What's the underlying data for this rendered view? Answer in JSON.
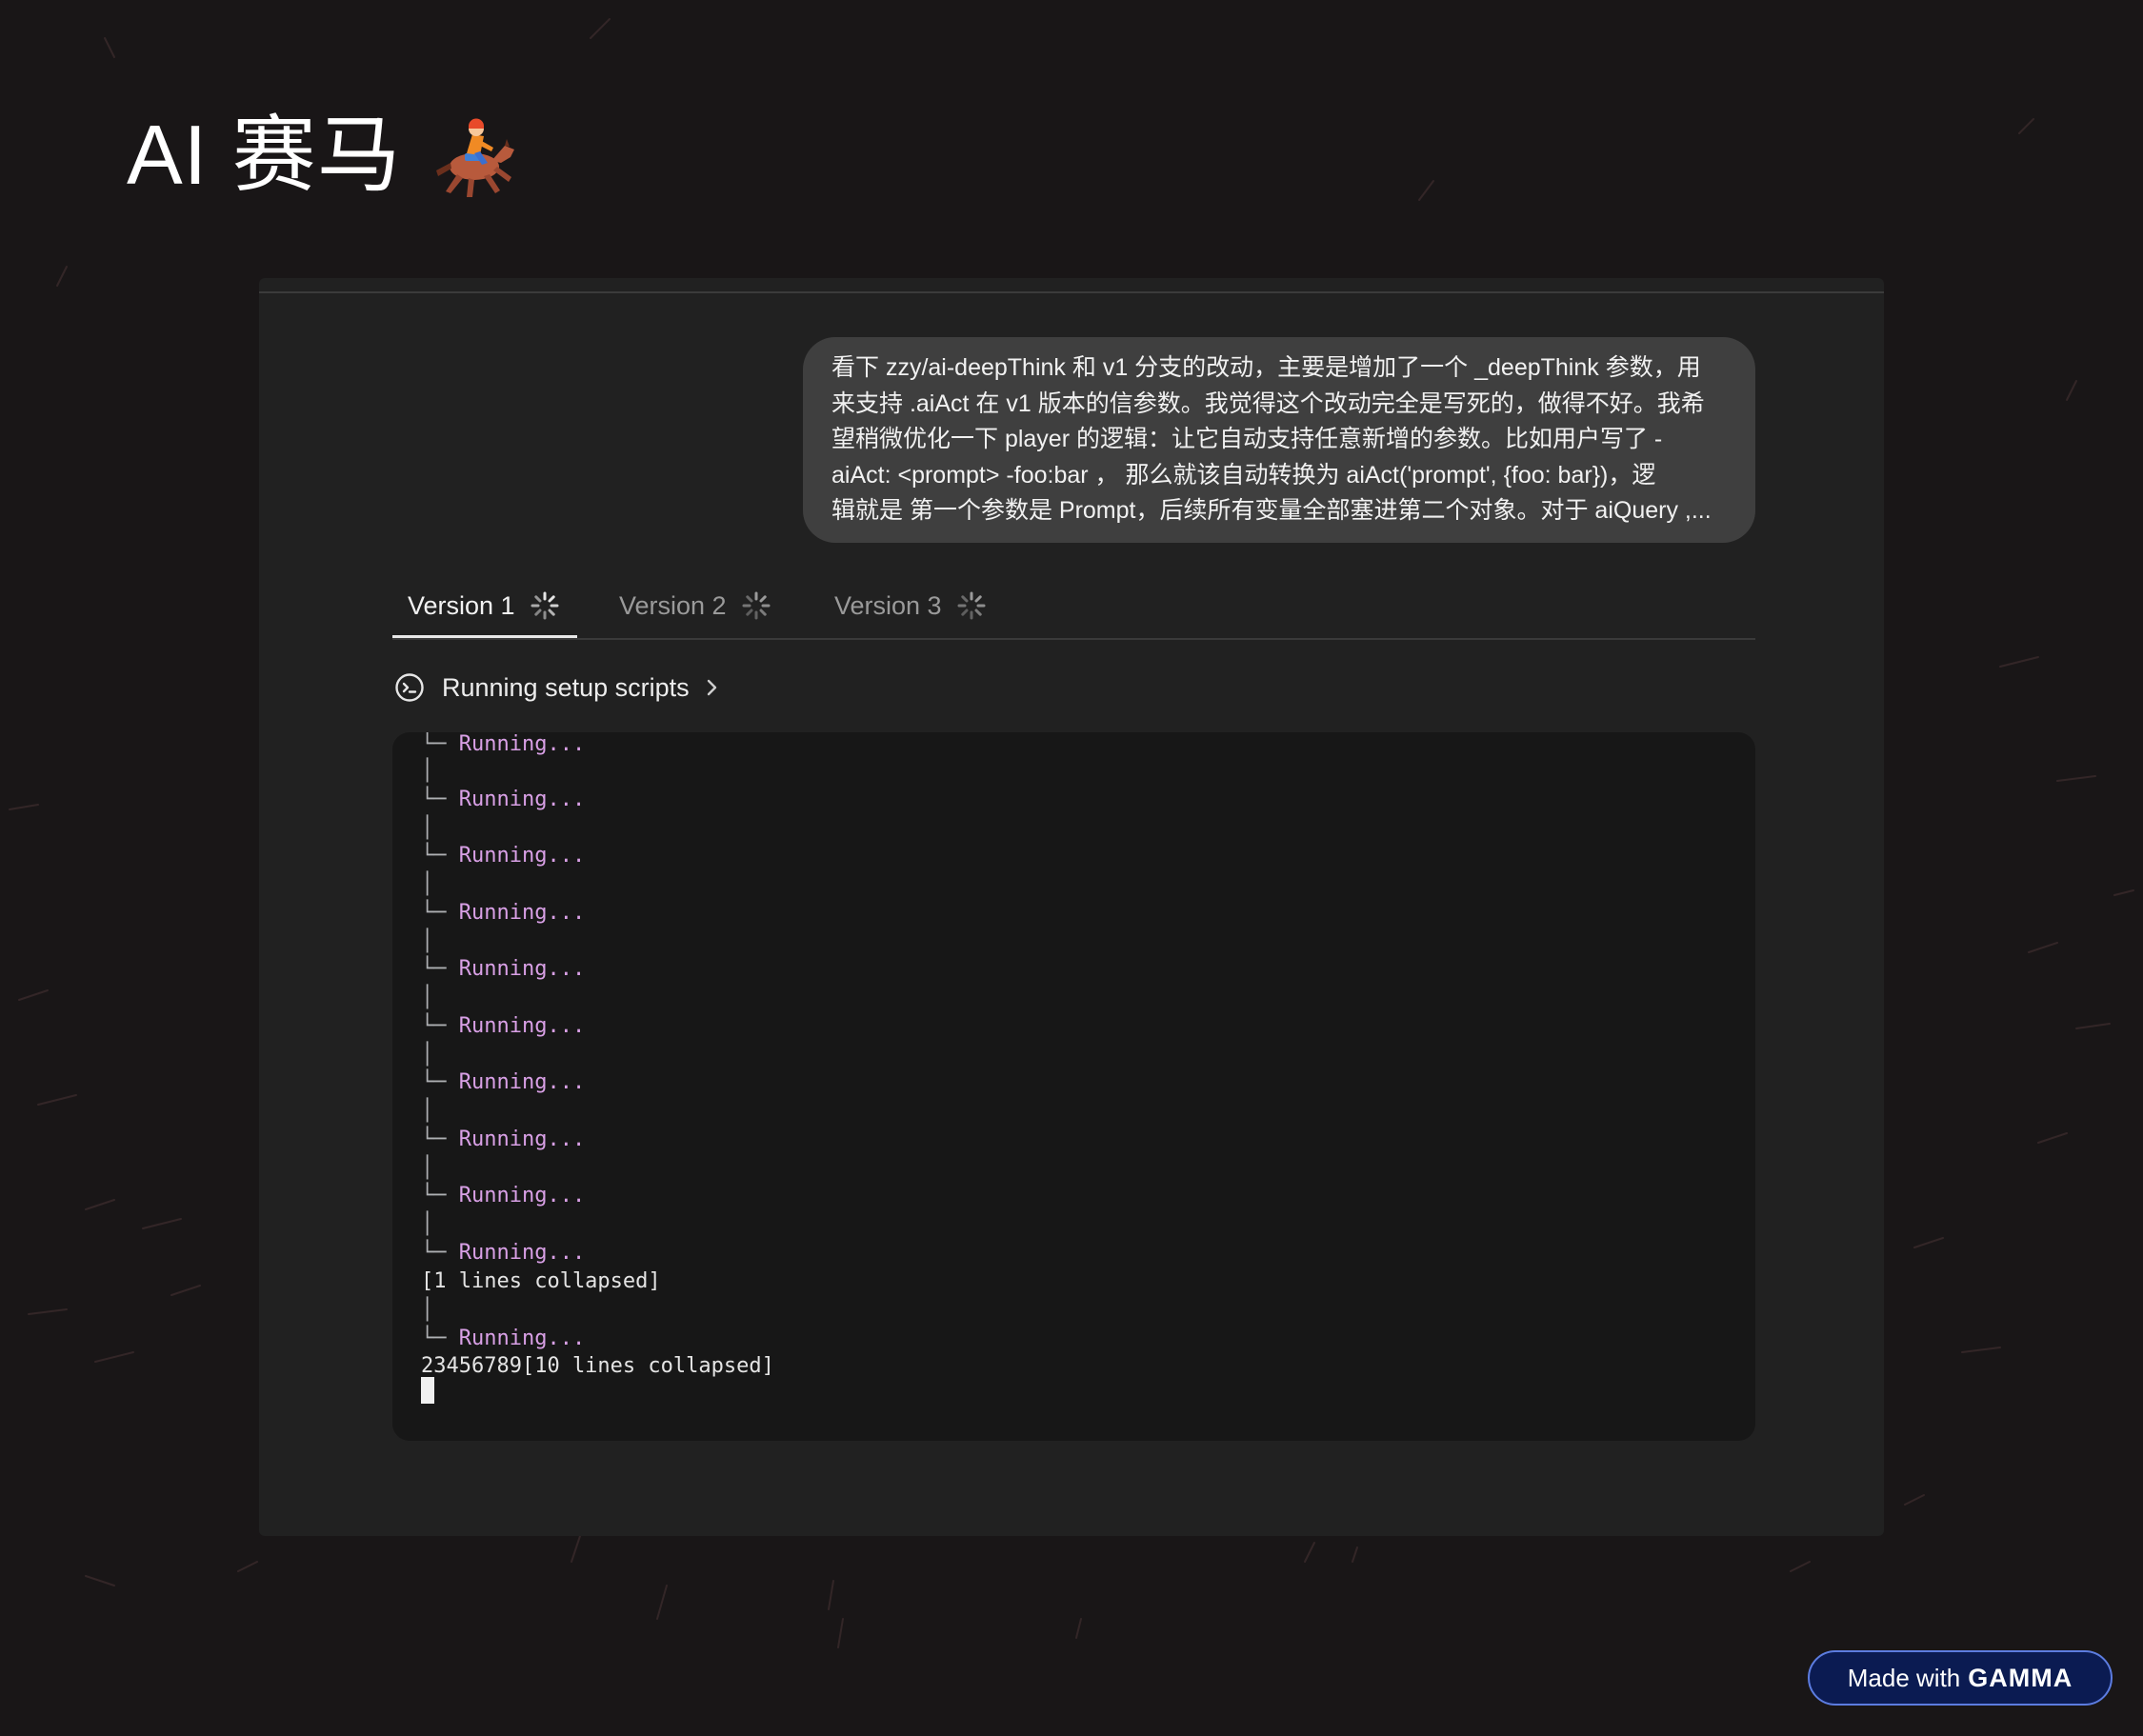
{
  "slide": {
    "title": "AI 赛马",
    "title_icon": "horse-racing-icon"
  },
  "prompt": {
    "lines": [
      "看下 zzy/ai-deepThink 和 v1 分支的改动，主要是增加了一个 _deepThink 参数，用",
      "来支持 .aiAct 在 v1 版本的信参数。我觉得这个改动完全是写死的，做得不好。我希",
      "望稍微优化一下 player 的逻辑：让它自动支持任意新增的参数。比如用户写了 -",
      "aiAct: <prompt> -foo:bar ， 那么就该自动转换为 aiAct('prompt', {foo: bar})，逻",
      "辑就是 第一个参数是 Prompt，后续所有变量全部塞进第二个对象。对于 aiQuery ,..."
    ]
  },
  "tabs": [
    {
      "label": "Version 1",
      "active": true,
      "icon": "loading-spinner-icon"
    },
    {
      "label": "Version 2",
      "active": false,
      "icon": "loading-spinner-icon"
    },
    {
      "label": "Version 3",
      "active": false,
      "icon": "loading-spinner-icon"
    }
  ],
  "setup": {
    "label": "Running setup scripts",
    "icon": "terminal-icon",
    "chevron": "chevron-right-icon"
  },
  "terminal": {
    "branch_glyph": "└─",
    "pipe_glyph": "│",
    "running_text": "Running...",
    "collapsed_1": "[1 lines collapsed]",
    "collapsed_2": "23456789[10 lines collapsed]"
  },
  "badge": {
    "text": "Made with",
    "brand": "GAMMA"
  },
  "colors": {
    "background": "#191617",
    "card": "#212121",
    "bubble": "#3f3f3f",
    "terminal_bg": "#171717",
    "running_text": "#d9a0e6",
    "badge_bg": "#0b1b52",
    "badge_border": "#5c7ce0"
  }
}
